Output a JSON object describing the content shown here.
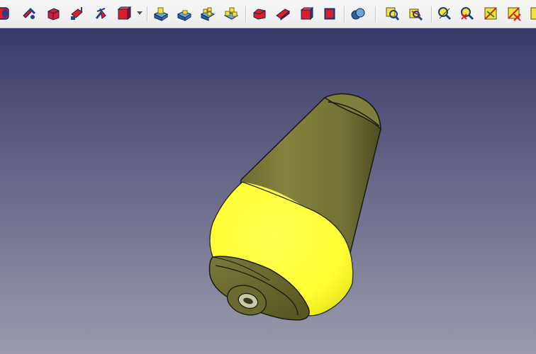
{
  "toolbar": {
    "tools": [
      {
        "name": "cylinder-tool-icon"
      },
      {
        "name": "revolve-tool-icon"
      },
      {
        "name": "extrude-tool-icon"
      },
      {
        "name": "mirror-tool-icon"
      },
      {
        "name": "fillet-tool-icon"
      },
      {
        "name": "box-tool-icon"
      },
      {
        "name": "boolean-common-icon"
      },
      {
        "name": "boolean-cut-icon"
      },
      {
        "name": "boolean-fuse-icon"
      },
      {
        "name": "compound-icon"
      },
      {
        "name": "chamfer-icon"
      },
      {
        "name": "make-face-icon"
      },
      {
        "name": "thickness-icon"
      },
      {
        "name": "offset-icon"
      },
      {
        "name": "sphere-icon"
      },
      {
        "name": "check-geometry-icon"
      },
      {
        "name": "measure-icon"
      },
      {
        "name": "measure-linear-icon"
      },
      {
        "name": "measure-angular-icon"
      },
      {
        "name": "measure-refresh-icon"
      },
      {
        "name": "measure-clear-icon"
      }
    ]
  },
  "viewport": {
    "background_top": "#3b3b6b",
    "background_bottom": "#9a9aac",
    "model_color": "#7b7a3a",
    "selected_face_color": "#ffff33",
    "edge_color": "#1a1a10"
  }
}
